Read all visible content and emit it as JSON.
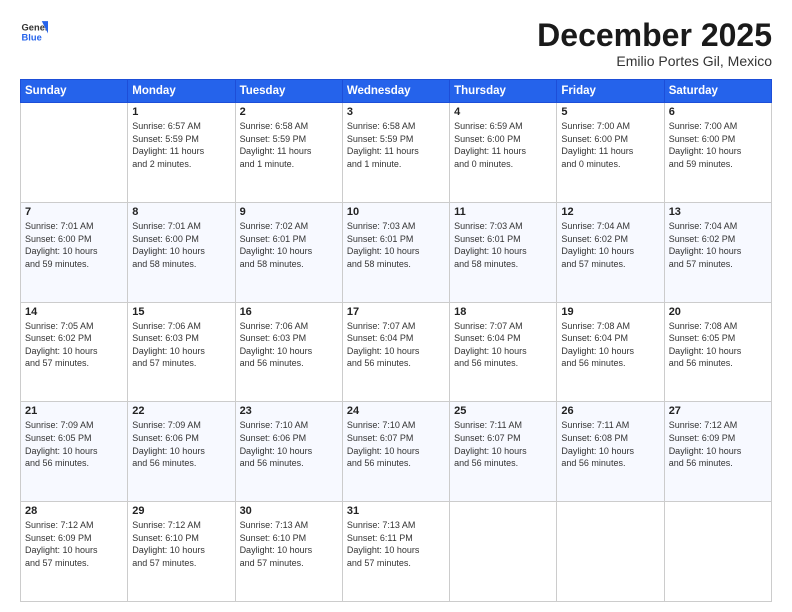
{
  "header": {
    "logo_line1": "General",
    "logo_line2": "Blue",
    "month": "December 2025",
    "location": "Emilio Portes Gil, Mexico"
  },
  "weekdays": [
    "Sunday",
    "Monday",
    "Tuesday",
    "Wednesday",
    "Thursday",
    "Friday",
    "Saturday"
  ],
  "weeks": [
    [
      {
        "day": "",
        "info": ""
      },
      {
        "day": "1",
        "info": "Sunrise: 6:57 AM\nSunset: 5:59 PM\nDaylight: 11 hours\nand 2 minutes."
      },
      {
        "day": "2",
        "info": "Sunrise: 6:58 AM\nSunset: 5:59 PM\nDaylight: 11 hours\nand 1 minute."
      },
      {
        "day": "3",
        "info": "Sunrise: 6:58 AM\nSunset: 5:59 PM\nDaylight: 11 hours\nand 1 minute."
      },
      {
        "day": "4",
        "info": "Sunrise: 6:59 AM\nSunset: 6:00 PM\nDaylight: 11 hours\nand 0 minutes."
      },
      {
        "day": "5",
        "info": "Sunrise: 7:00 AM\nSunset: 6:00 PM\nDaylight: 11 hours\nand 0 minutes."
      },
      {
        "day": "6",
        "info": "Sunrise: 7:00 AM\nSunset: 6:00 PM\nDaylight: 10 hours\nand 59 minutes."
      }
    ],
    [
      {
        "day": "7",
        "info": "Sunrise: 7:01 AM\nSunset: 6:00 PM\nDaylight: 10 hours\nand 59 minutes."
      },
      {
        "day": "8",
        "info": "Sunrise: 7:01 AM\nSunset: 6:00 PM\nDaylight: 10 hours\nand 58 minutes."
      },
      {
        "day": "9",
        "info": "Sunrise: 7:02 AM\nSunset: 6:01 PM\nDaylight: 10 hours\nand 58 minutes."
      },
      {
        "day": "10",
        "info": "Sunrise: 7:03 AM\nSunset: 6:01 PM\nDaylight: 10 hours\nand 58 minutes."
      },
      {
        "day": "11",
        "info": "Sunrise: 7:03 AM\nSunset: 6:01 PM\nDaylight: 10 hours\nand 58 minutes."
      },
      {
        "day": "12",
        "info": "Sunrise: 7:04 AM\nSunset: 6:02 PM\nDaylight: 10 hours\nand 57 minutes."
      },
      {
        "day": "13",
        "info": "Sunrise: 7:04 AM\nSunset: 6:02 PM\nDaylight: 10 hours\nand 57 minutes."
      }
    ],
    [
      {
        "day": "14",
        "info": "Sunrise: 7:05 AM\nSunset: 6:02 PM\nDaylight: 10 hours\nand 57 minutes."
      },
      {
        "day": "15",
        "info": "Sunrise: 7:06 AM\nSunset: 6:03 PM\nDaylight: 10 hours\nand 57 minutes."
      },
      {
        "day": "16",
        "info": "Sunrise: 7:06 AM\nSunset: 6:03 PM\nDaylight: 10 hours\nand 56 minutes."
      },
      {
        "day": "17",
        "info": "Sunrise: 7:07 AM\nSunset: 6:04 PM\nDaylight: 10 hours\nand 56 minutes."
      },
      {
        "day": "18",
        "info": "Sunrise: 7:07 AM\nSunset: 6:04 PM\nDaylight: 10 hours\nand 56 minutes."
      },
      {
        "day": "19",
        "info": "Sunrise: 7:08 AM\nSunset: 6:04 PM\nDaylight: 10 hours\nand 56 minutes."
      },
      {
        "day": "20",
        "info": "Sunrise: 7:08 AM\nSunset: 6:05 PM\nDaylight: 10 hours\nand 56 minutes."
      }
    ],
    [
      {
        "day": "21",
        "info": "Sunrise: 7:09 AM\nSunset: 6:05 PM\nDaylight: 10 hours\nand 56 minutes."
      },
      {
        "day": "22",
        "info": "Sunrise: 7:09 AM\nSunset: 6:06 PM\nDaylight: 10 hours\nand 56 minutes."
      },
      {
        "day": "23",
        "info": "Sunrise: 7:10 AM\nSunset: 6:06 PM\nDaylight: 10 hours\nand 56 minutes."
      },
      {
        "day": "24",
        "info": "Sunrise: 7:10 AM\nSunset: 6:07 PM\nDaylight: 10 hours\nand 56 minutes."
      },
      {
        "day": "25",
        "info": "Sunrise: 7:11 AM\nSunset: 6:07 PM\nDaylight: 10 hours\nand 56 minutes."
      },
      {
        "day": "26",
        "info": "Sunrise: 7:11 AM\nSunset: 6:08 PM\nDaylight: 10 hours\nand 56 minutes."
      },
      {
        "day": "27",
        "info": "Sunrise: 7:12 AM\nSunset: 6:09 PM\nDaylight: 10 hours\nand 56 minutes."
      }
    ],
    [
      {
        "day": "28",
        "info": "Sunrise: 7:12 AM\nSunset: 6:09 PM\nDaylight: 10 hours\nand 57 minutes."
      },
      {
        "day": "29",
        "info": "Sunrise: 7:12 AM\nSunset: 6:10 PM\nDaylight: 10 hours\nand 57 minutes."
      },
      {
        "day": "30",
        "info": "Sunrise: 7:13 AM\nSunset: 6:10 PM\nDaylight: 10 hours\nand 57 minutes."
      },
      {
        "day": "31",
        "info": "Sunrise: 7:13 AM\nSunset: 6:11 PM\nDaylight: 10 hours\nand 57 minutes."
      },
      {
        "day": "",
        "info": ""
      },
      {
        "day": "",
        "info": ""
      },
      {
        "day": "",
        "info": ""
      }
    ]
  ]
}
